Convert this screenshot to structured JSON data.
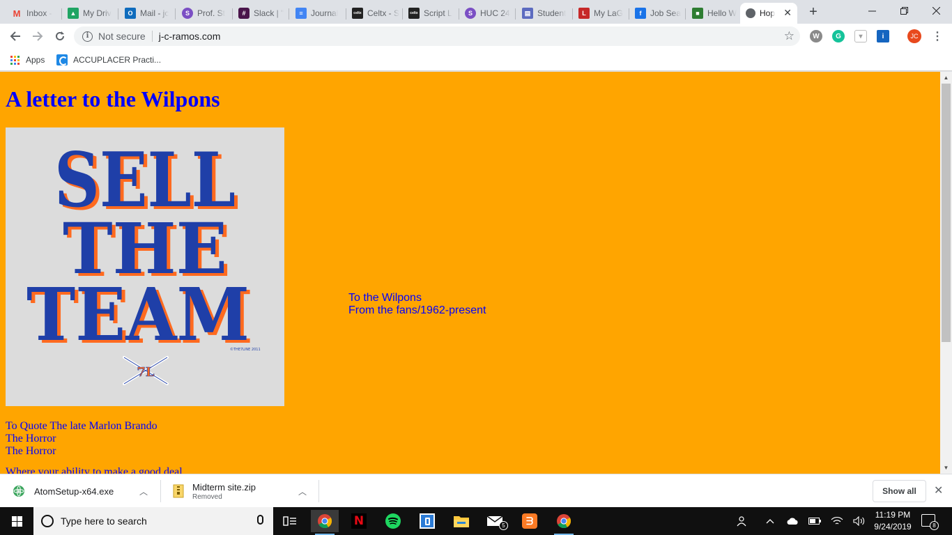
{
  "browser": {
    "tabs": [
      {
        "label": "Inbox -",
        "icon": "gmail-icon",
        "color": "#ea4335",
        "glyph": "M"
      },
      {
        "label": "My Driv",
        "icon": "google-drive-icon",
        "color": "#1fa463",
        "glyph": "▲"
      },
      {
        "label": "Mail - jc",
        "icon": "outlook-icon",
        "color": "#0f6cbd",
        "glyph": "O"
      },
      {
        "label": "Prof. St",
        "icon": "simplenote-icon",
        "color": "#7b4fc4",
        "glyph": "S"
      },
      {
        "label": "Slack | \"",
        "icon": "slack-icon",
        "color": "#4a154b",
        "glyph": "#"
      },
      {
        "label": "Journal",
        "icon": "google-docs-icon",
        "color": "#4285f4",
        "glyph": "≡"
      },
      {
        "label": "Celtx - S",
        "icon": "celtx-icon",
        "color": "#222222",
        "glyph": "celtx"
      },
      {
        "label": "Script L",
        "icon": "celtx-icon",
        "color": "#222222",
        "glyph": "celtx"
      },
      {
        "label": "HUC 24",
        "icon": "simplenote-icon",
        "color": "#7b4fc4",
        "glyph": "S"
      },
      {
        "label": "Student",
        "icon": "document-icon",
        "color": "#5c6bc0",
        "glyph": "▤"
      },
      {
        "label": "My LaG",
        "icon": "lagcc-icon",
        "color": "#c62828",
        "glyph": "L"
      },
      {
        "label": "Job Sea",
        "icon": "job-search-icon",
        "color": "#1a73e8",
        "glyph": "f"
      },
      {
        "label": "Hello W",
        "icon": "cube-icon",
        "color": "#2e7d32",
        "glyph": "■"
      }
    ],
    "active_tab": {
      "label": "Hop",
      "icon": "globe-icon"
    },
    "url_security": "Not secure",
    "url": "j-c-ramos.com",
    "profile_initials": "JC",
    "bookmarks": [
      {
        "label": "Apps",
        "icon": "apps-grid-icon"
      },
      {
        "label": "ACCUPLACER Practi...",
        "icon": "accuplacer-icon"
      }
    ]
  },
  "page": {
    "title": "A letter to the Wilpons",
    "poster": {
      "lines": [
        "SELL",
        "THE",
        "TEAM"
      ],
      "copyright": "©THE7LINE 2011",
      "logo_text": "7L",
      "primary_color": "#1f3fa8",
      "shadow_color": "#ff6a1f",
      "background": "#dcdcdc"
    },
    "side_note": [
      "To the Wilpons",
      "From the fans/1962-present"
    ],
    "quote": [
      "To Quote The late Marlon Brando",
      "The Horror",
      "The Horror"
    ],
    "cut_line": "Where your ability to make a good deal",
    "background": "#ffa500",
    "text_color": "#0000ff"
  },
  "downloads": {
    "items": [
      {
        "name": "AtomSetup-x64.exe",
        "status": "",
        "icon": "atom-installer-icon"
      },
      {
        "name": "Midterm site.zip",
        "status": "Removed",
        "icon": "zip-file-icon"
      }
    ],
    "show_all_label": "Show all"
  },
  "taskbar": {
    "search_placeholder": "Type here to search",
    "apps": [
      "chrome-icon",
      "netflix-icon",
      "spotify-icon",
      "device-manager-icon",
      "file-explorer-icon",
      "mail-icon",
      "xampp-icon",
      "chrome-icon"
    ],
    "mail_badge": "5",
    "time": "11:19 PM",
    "date": "9/24/2019",
    "notification_count": "8"
  }
}
